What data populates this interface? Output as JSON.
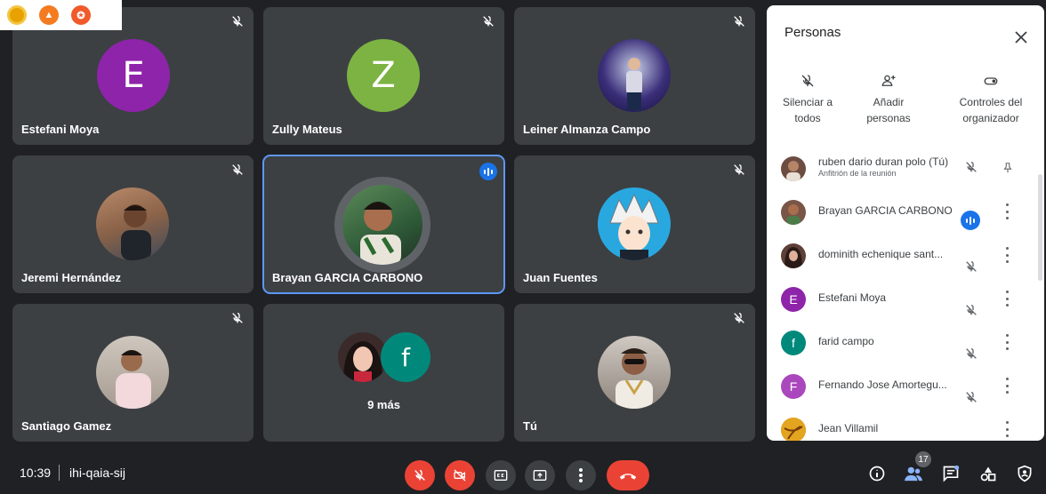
{
  "meeting": {
    "time": "10:39",
    "code": "ihi-qaia-sij",
    "participant_count": "17"
  },
  "tiles": [
    {
      "name": "Estefani Moya",
      "avatar_letter": "E",
      "avatar_color": "#8e24aa",
      "muted": true
    },
    {
      "name": "Zully Mateus",
      "avatar_letter": "Z",
      "avatar_color": "#7cb342",
      "muted": true
    },
    {
      "name": "Leiner Almanza Campo",
      "avatar_photo": "photo-avatar",
      "muted": true
    },
    {
      "name": "Jeremi Hernández",
      "avatar_photo": "photo-avatar",
      "muted": true
    },
    {
      "name": "Brayan GARCIA CARBONO",
      "avatar_photo": "photo-avatar",
      "speaking": true
    },
    {
      "name": "Juan Fuentes",
      "avatar_photo": "photo-avatar",
      "muted": true
    },
    {
      "name": "Santiago Gamez",
      "avatar_photo": "photo-avatar",
      "muted": true
    },
    {
      "more_label": "9 más",
      "avatar_letter": "f",
      "avatar_color": "#00897b"
    },
    {
      "name": "Tú",
      "avatar_photo": "photo-avatar",
      "muted": true
    }
  ],
  "panel": {
    "title": "Personas",
    "controls": [
      {
        "label_line1": "Silenciar a",
        "label_line2": "todos",
        "icon": "mic-off-icon"
      },
      {
        "label_line1": "Añadir",
        "label_line2": "personas",
        "icon": "add-person-icon"
      },
      {
        "label_line1": "Controles del",
        "label_line2": "organizador",
        "icon": "toggle-icon"
      }
    ],
    "participants": [
      {
        "name": "ruben dario duran polo (Tú)",
        "subtitle": "Anfitrión de la reunión",
        "avatar_color": "#6d4c41"
      },
      {
        "name": "Brayan GARCIA CARBONO",
        "avatar_color": "#795548"
      },
      {
        "name": "dominith echenique sant...",
        "avatar_color": "#5d4037"
      },
      {
        "name": "Estefani Moya",
        "avatar_letter": "E",
        "avatar_color": "#8e24aa"
      },
      {
        "name": "farid campo",
        "avatar_letter": "f",
        "avatar_color": "#00897b"
      },
      {
        "name": "Fernando Jose Amortegu...",
        "avatar_letter": "F",
        "avatar_color": "#ab47bc"
      },
      {
        "name": "Jean Villamil",
        "avatar_color": "#c77800"
      }
    ]
  },
  "colors": {
    "background": "#202124",
    "tile": "#3c4043",
    "accent_blue": "#1a73e8",
    "red": "#ea4335"
  }
}
